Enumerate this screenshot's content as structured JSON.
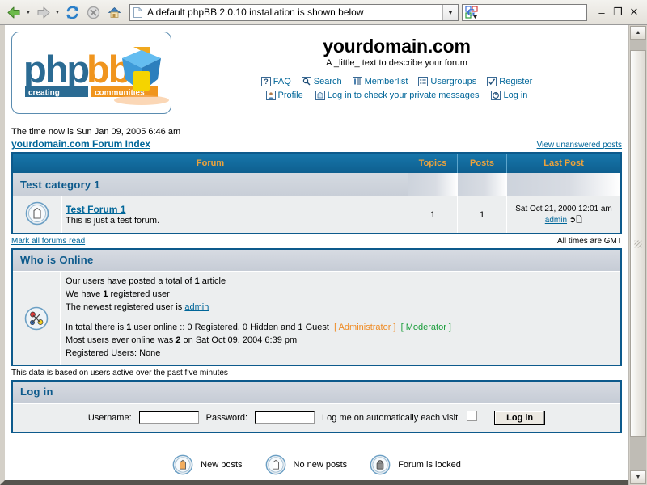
{
  "browser": {
    "back_label": "Back",
    "forward_label": "Forward",
    "reload_label": "Reload",
    "stop_label": "Stop",
    "home_label": "Home",
    "url_text": "A default phpBB 2.0.10 installation is shown below",
    "search_text": "",
    "search_placeholder": "",
    "search_engine": "G",
    "minimize_label": "–",
    "restore_label": "❐",
    "close_label": "✕"
  },
  "forum": {
    "site_title": "yourdomain.com",
    "site_description": "A _little_ text to describe your forum",
    "nav_row1": [
      {
        "label": "FAQ",
        "icon": "faq-icon"
      },
      {
        "label": "Search",
        "icon": "search-icon"
      },
      {
        "label": "Memberlist",
        "icon": "memberlist-icon"
      },
      {
        "label": "Usergroups",
        "icon": "usergroups-icon"
      },
      {
        "label": "Register",
        "icon": "register-icon"
      }
    ],
    "nav_row2": [
      {
        "label": "Profile",
        "icon": "profile-icon"
      },
      {
        "label": "Log in to check your private messages",
        "icon": "pm-icon"
      },
      {
        "label": "Log in",
        "icon": "login-icon"
      }
    ],
    "time_now": "The time now is Sun Jan 09, 2005 6:46 am",
    "index_link": "yourdomain.com Forum Index",
    "view_unanswered": "View unanswered posts",
    "table_headers": {
      "forum": "Forum",
      "topics": "Topics",
      "posts": "Posts",
      "last_post": "Last Post"
    },
    "category_name": "Test category 1",
    "rows": [
      {
        "title": "Test Forum 1",
        "description": "This is just a test forum.",
        "topics": "1",
        "posts": "1",
        "last_post_date": "Sat Oct 21, 2000 12:01 am",
        "last_post_author": "admin"
      }
    ],
    "mark_all_read": "Mark all forums read",
    "times_gmt": "All times are GMT",
    "who_is_online": {
      "heading": "Who is Online",
      "line1_pre": "Our users have posted a total of ",
      "line1_count": "1",
      "line1_post": " article",
      "line2_pre": "We have ",
      "line2_count": "1",
      "line2_post": " registered user",
      "line3_pre": "The newest registered user is ",
      "line3_user": "admin",
      "line4_pre": "In total there is ",
      "line4_count": "1",
      "line4_mid": " user online :: 0 Registered, 0 Hidden and 1 Guest",
      "badge_admin": "[ Administrator ]",
      "badge_mod": "[ Moderator ]",
      "line5_pre": "Most users ever online was ",
      "line5_count": "2",
      "line5_post": " on Sat Oct 09, 2004 6:39 pm",
      "line6": "Registered Users: None"
    },
    "five_minutes": "This data is based on users active over the past five minutes",
    "login": {
      "heading": "Log in",
      "username_label": "Username:",
      "username_value": "",
      "password_label": "Password:",
      "password_value": "",
      "autologin_label": "Log me on automatically each visit",
      "button_label": "Log in"
    },
    "legend": [
      {
        "label": "New posts",
        "icon": "new-posts-icon"
      },
      {
        "label": "No new posts",
        "icon": "no-new-posts-icon"
      },
      {
        "label": "Forum is locked",
        "icon": "forum-locked-icon"
      }
    ]
  },
  "colors": {
    "header_blue": "#0e5f8f",
    "header_orange": "#eba23c",
    "link_blue": "#006699",
    "admin_orange": "#ef8a22",
    "moderator_green": "#1a9d3b"
  }
}
